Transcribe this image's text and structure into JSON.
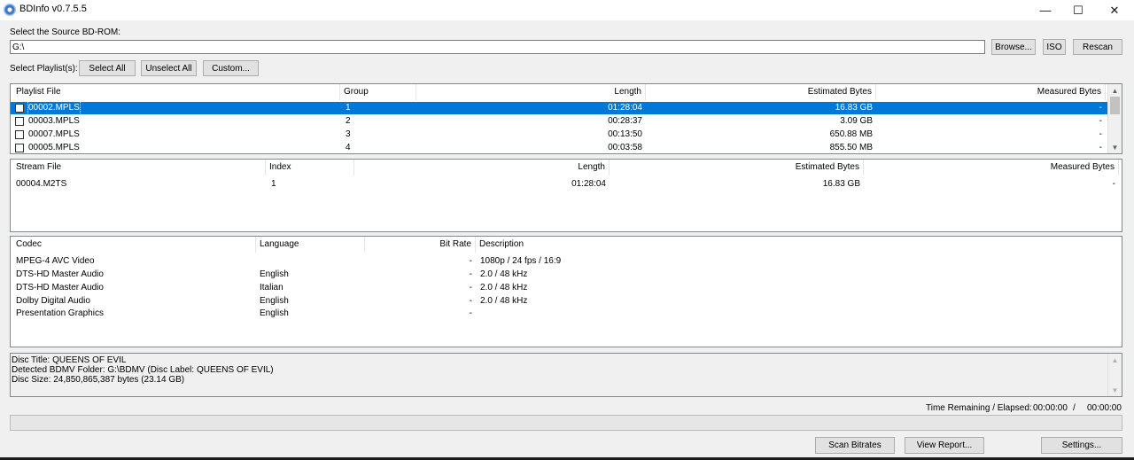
{
  "window": {
    "title": "BDInfo v0.7.5.5",
    "minimize_glyph": "—",
    "maximize_glyph": "☐",
    "close_glyph": "✕"
  },
  "source": {
    "label": "Select the Source BD-ROM:",
    "path": "G:\\",
    "browse_label": "Browse...",
    "iso_label": "ISO",
    "rescan_label": "Rescan"
  },
  "playlist_select": {
    "label": "Select Playlist(s):",
    "select_all": "Select All",
    "unselect_all": "Unselect All",
    "custom": "Custom..."
  },
  "playlists": {
    "columns": [
      "Playlist File",
      "Group",
      "Length",
      "Estimated Bytes",
      "Measured Bytes"
    ],
    "rows": [
      {
        "file": "00002.MPLS",
        "group": "1",
        "length": "01:28:04",
        "estimated": "16.83 GB",
        "measured": "-",
        "selected": true
      },
      {
        "file": "00003.MPLS",
        "group": "2",
        "length": "00:28:37",
        "estimated": "3.09 GB",
        "measured": "-",
        "selected": false
      },
      {
        "file": "00007.MPLS",
        "group": "3",
        "length": "00:13:50",
        "estimated": "650.88 MB",
        "measured": "-",
        "selected": false
      },
      {
        "file": "00005.MPLS",
        "group": "4",
        "length": "00:03:58",
        "estimated": "855.50 MB",
        "measured": "-",
        "selected": false
      }
    ]
  },
  "streams": {
    "columns": [
      "Stream File",
      "Index",
      "Length",
      "Estimated Bytes",
      "Measured Bytes"
    ],
    "rows": [
      {
        "file": "00004.M2TS",
        "index": "1",
        "length": "01:28:04",
        "estimated": "16.83 GB",
        "measured": "-"
      }
    ]
  },
  "codecs": {
    "columns": [
      "Codec",
      "Language",
      "Bit Rate",
      "Description"
    ],
    "rows": [
      {
        "codec": "MPEG-4 AVC Video",
        "language": "",
        "bitrate": "-",
        "description": "1080p / 24 fps / 16:9"
      },
      {
        "codec": "DTS-HD Master Audio",
        "language": "English",
        "bitrate": "-",
        "description": "2.0 / 48 kHz"
      },
      {
        "codec": "DTS-HD Master Audio",
        "language": "Italian",
        "bitrate": "-",
        "description": "2.0 / 48 kHz"
      },
      {
        "codec": "Dolby Digital Audio",
        "language": "English",
        "bitrate": "-",
        "description": "2.0 / 48 kHz"
      },
      {
        "codec": "Presentation Graphics",
        "language": "English",
        "bitrate": "-",
        "description": ""
      }
    ]
  },
  "info": {
    "lines": [
      "Disc Title: QUEENS OF EVIL",
      "Detected BDMV Folder: G:\\BDMV (Disc Label: QUEENS OF EVIL)",
      "Disc Size: 24,850,865,387 bytes (23.14 GB)"
    ]
  },
  "timer": {
    "label": "Time Remaining / Elapsed:",
    "remaining": "00:00:00",
    "separator": "/",
    "elapsed": "00:00:00"
  },
  "progress": {
    "fraction": 0
  },
  "actions": {
    "scan": "Scan Bitrates",
    "report": "View Report...",
    "settings": "Settings..."
  }
}
